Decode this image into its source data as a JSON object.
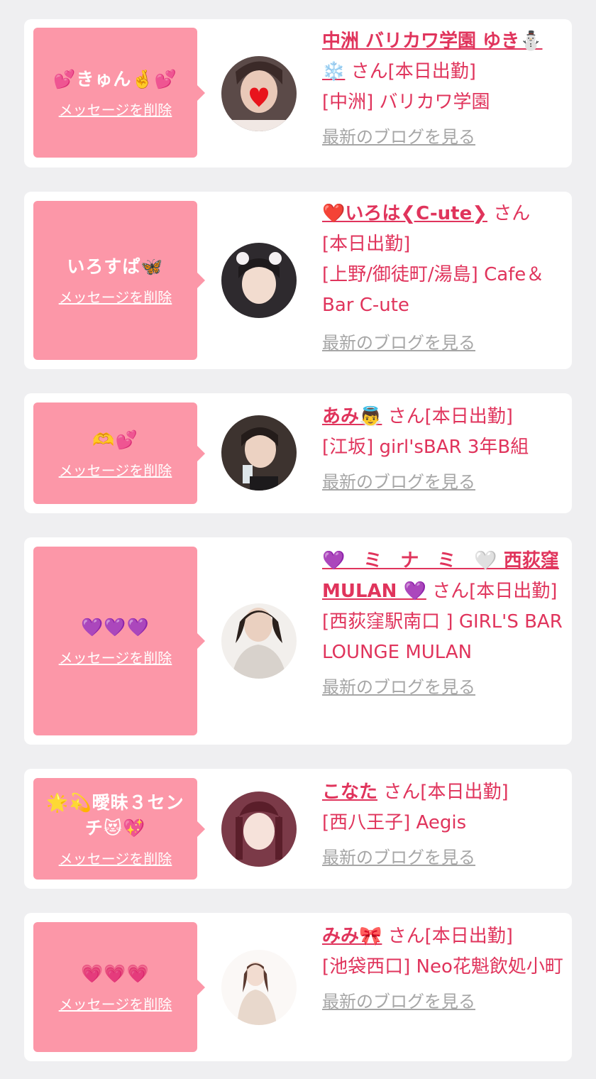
{
  "messages": [
    {
      "message": "💕きゅん🤞💕",
      "delete_label": "メッセージを削除",
      "cast_name": "中洲 バリカワ学園 ゆき⛄️❄️",
      "honorific": "さん",
      "status": "[本日出勤]",
      "shop": "[中洲] バリカワ学園",
      "blog_label": "最新のブログを見る",
      "avatar_color": "#5b4a48"
    },
    {
      "message": "いろすぱ🦋",
      "delete_label": "メッセージを削除",
      "cast_name": "❤️いろは❮C-ute❯",
      "honorific": "さん",
      "status": "[本日出勤]",
      "shop": "[上野/御徒町/湯島] Cafe＆Bar C-ute",
      "blog_label": "最新のブログを見る",
      "avatar_color": "#2e2a2e"
    },
    {
      "message": "🫶💕",
      "delete_label": "メッセージを削除",
      "cast_name": "あみ👼",
      "honorific": "さん",
      "status": "[本日出勤]",
      "shop": "[江坂] girl'sBAR 3年B組",
      "blog_label": "最新のブログを見る",
      "avatar_color": "#3d332f"
    },
    {
      "message": "💜💜💜",
      "delete_label": "メッセージを削除",
      "cast_name": "💜　ミ　ナ　ミ　🤍 西荻窪 MULAN 💜",
      "honorific": "さん",
      "status": "[本日出勤]",
      "shop": "[西荻窪駅南口 ] GIRL'S BAR LOUNGE MULAN",
      "blog_label": "最新のブログを見る",
      "avatar_color": "#d8d2cc"
    },
    {
      "message": "🌟💫曖昧３センチ😻💖",
      "delete_label": "メッセージを削除",
      "cast_name": "こなた",
      "honorific": "さん",
      "status": "[本日出勤]",
      "shop": "[西八王子] Aegis",
      "blog_label": "最新のブログを見る",
      "avatar_color": "#7b3a48"
    },
    {
      "message": "💗💗💗",
      "delete_label": "メッセージを削除",
      "cast_name": "みみ🎀",
      "honorific": "さん",
      "status": "[本日出勤]",
      "shop": "[池袋西口] Neo花魁飲処小町",
      "blog_label": "最新のブログを見る",
      "avatar_color": "#e8d8cc"
    }
  ]
}
